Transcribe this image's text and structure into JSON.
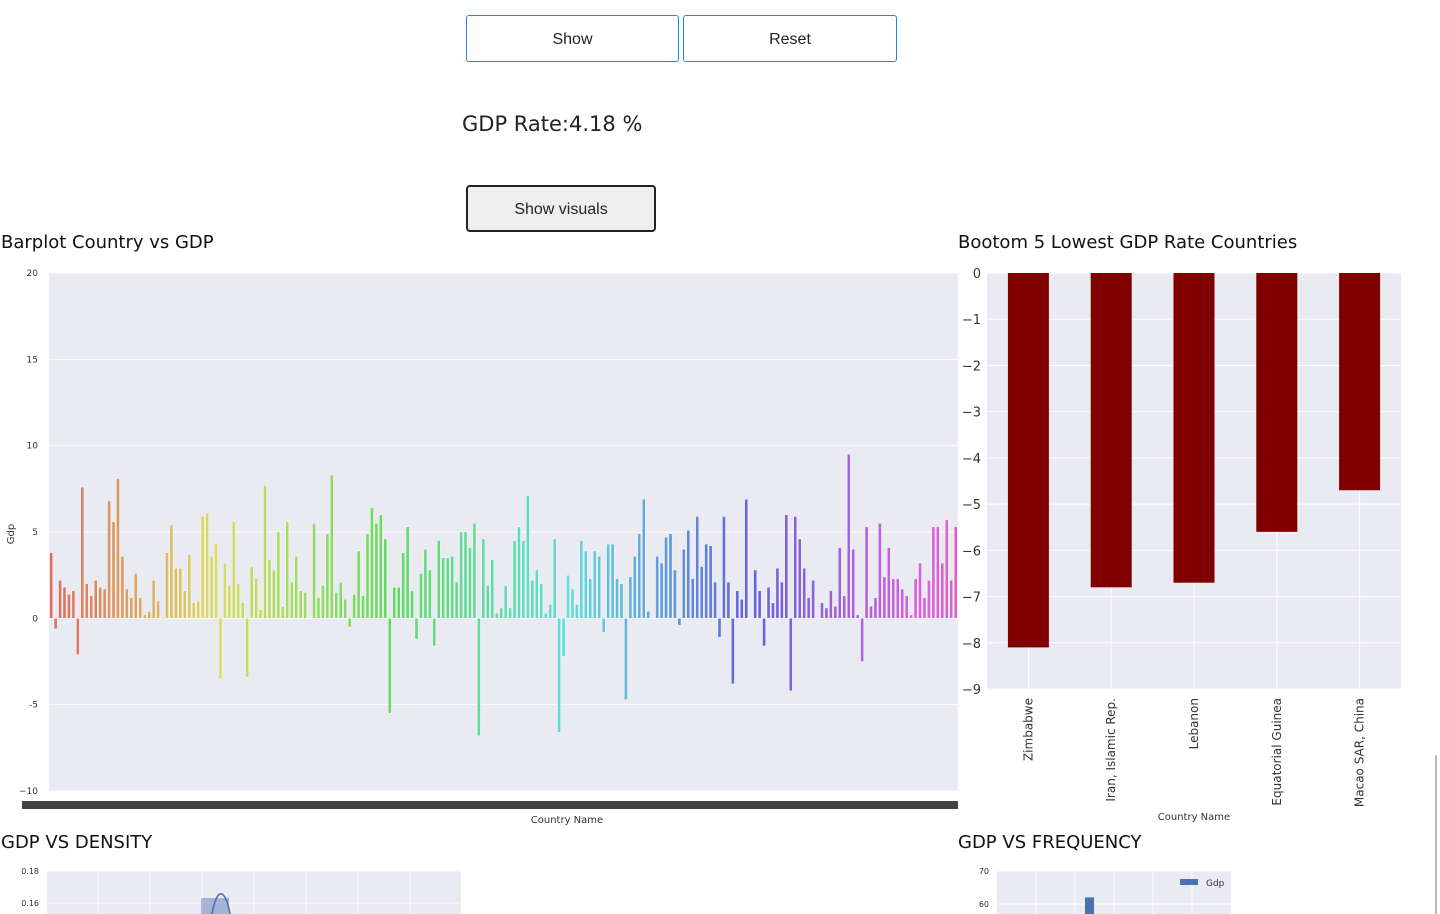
{
  "controls": {
    "show_label": "Show",
    "reset_label": "Reset",
    "gdp_rate_text": "GDP Rate:4.18 %",
    "show_visuals_label": "Show visuals"
  },
  "sections": {
    "barplot_title": "Barplot Country vs GDP",
    "bottom5_title": "Bootom 5 Lowest GDP Rate Countries",
    "density_title": "GDP VS DENSITY",
    "frequency_title": "GDP VS FREQUENCY"
  },
  "chart_data": [
    {
      "type": "bar",
      "xlabel": "Country Name",
      "ylabel": "Gdp",
      "ylim": [
        -10,
        20
      ],
      "yticks": [
        "20",
        "15",
        "10",
        "5",
        "0",
        "−10"
      ],
      "ytick_values": [
        20,
        15,
        10,
        5,
        0,
        -10
      ],
      "extra_ytick": {
        "label": "-5",
        "value": -5
      },
      "grid": true,
      "palette": "husl",
      "values": [
        3.8,
        -0.6,
        2.2,
        1.8,
        1.4,
        1.6,
        -2.1,
        7.6,
        2.0,
        1.3,
        2.2,
        1.8,
        1.7,
        6.8,
        5.6,
        8.1,
        3.6,
        1.7,
        1.2,
        2.6,
        1.2,
        0.2,
        0.4,
        2.2,
        1.0,
        -0.05,
        3.8,
        5.4,
        2.9,
        2.9,
        1.6,
        3.7,
        0.9,
        1.0,
        5.9,
        6.1,
        3.6,
        4.3,
        -3.5,
        3.2,
        1.9,
        5.6,
        2.0,
        0.9,
        -3.4,
        3.0,
        2.3,
        0.5,
        7.7,
        3.4,
        2.8,
        5.0,
        0.7,
        5.6,
        2.1,
        3.6,
        1.6,
        1.5,
        0,
        5.5,
        1.2,
        1.9,
        4.9,
        8.3,
        1.5,
        2.1,
        1.1,
        -0.5,
        1.4,
        3.9,
        1.3,
        4.9,
        6.4,
        5.5,
        6.0,
        4.6,
        -5.5,
        1.8,
        1.8,
        3.8,
        5.3,
        1.6,
        -1.2,
        2.6,
        4.0,
        2.8,
        -1.6,
        4.5,
        3.5,
        3.5,
        3.6,
        2.1,
        5.0,
        5.0,
        4.1,
        5.5,
        -6.8,
        4.6,
        1.9,
        3.4,
        0.3,
        0.6,
        1.9,
        0.6,
        4.5,
        5.3,
        4.5,
        7.1,
        2.2,
        2.8,
        2.0,
        0.3,
        0.8,
        4.6,
        -6.6,
        -2.2,
        2.5,
        1.7,
        0.8,
        4.5,
        3.9,
        2.3,
        3.9,
        3.6,
        -0.8,
        4.3,
        4.3,
        2.3,
        2.0,
        -4.7,
        2.4,
        3.6,
        4.9,
        6.9,
        0.4,
        0,
        3.6,
        3.2,
        4.7,
        4.9,
        2.8,
        -0.4,
        4.0,
        5.1,
        2.3,
        5.9,
        3.0,
        4.3,
        4.2,
        2.1,
        -1.1,
        5.9,
        2.1,
        -3.8,
        1.6,
        1.1,
        6.9,
        0,
        2.8,
        1.6,
        -1.6,
        1.8,
        0.9,
        2.9,
        2.1,
        6.0,
        -4.2,
        5.9,
        4.6,
        2.9,
        1.2,
        2.2,
        0,
        0.9,
        0.6,
        1.6,
        0.7,
        4.1,
        1.3,
        9.5,
        4.0,
        0.2,
        -2.5,
        5.3,
        0.7,
        1.2,
        5.5,
        2.4,
        4.1,
        2.3,
        2.3,
        1.7,
        1.3,
        0.2,
        2.3,
        3.2,
        1.2,
        2.2,
        5.3,
        5.3,
        3.2,
        5.7,
        2.2,
        5.3
      ]
    },
    {
      "type": "bar",
      "xlabel": "Country Name",
      "ylim": [
        -9,
        0
      ],
      "yticks": [
        "0",
        "−1",
        "−2",
        "−3",
        "−4",
        "−5",
        "−6",
        "−7",
        "−8",
        "−9"
      ],
      "grid": true,
      "color": "#800000",
      "categories": [
        "Zimbabwe",
        "Iran, Islamic Rep.",
        "Lebanon",
        "Equatorial Guinea",
        "Macao SAR, China"
      ],
      "values": [
        -8.1,
        -6.8,
        -6.7,
        -5.6,
        -4.7
      ]
    },
    {
      "type": "area",
      "yticks": [
        "0.18",
        "0.16"
      ],
      "ytick_values": [
        0.18,
        0.16
      ],
      "color": "#4c72b0",
      "grid": true
    },
    {
      "type": "bar",
      "yticks": [
        "70",
        "60"
      ],
      "ytick_values": [
        70,
        60
      ],
      "legend": [
        "Gdp"
      ],
      "legend_position": "top-right",
      "color": "#4c72b0",
      "grid": true,
      "visible_bar_value": 62
    }
  ]
}
